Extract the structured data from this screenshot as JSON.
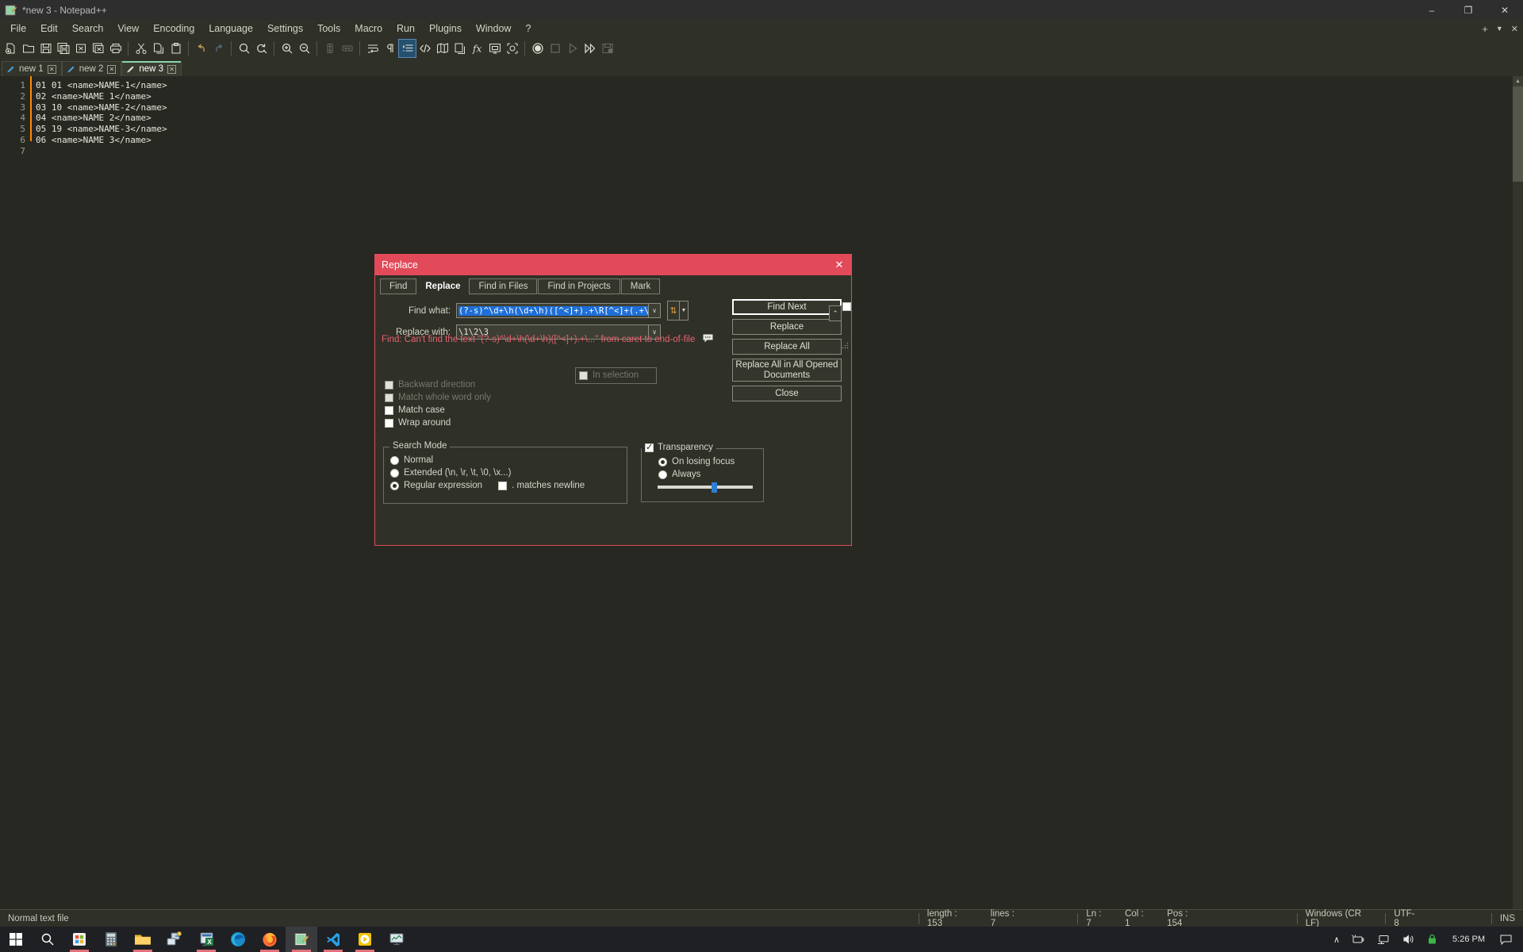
{
  "window": {
    "title": "*new 3 - Notepad++",
    "minimize": "–",
    "maximize": "❐",
    "close": "✕"
  },
  "menubar": {
    "items": [
      {
        "label": "File"
      },
      {
        "label": "Edit"
      },
      {
        "label": "Search"
      },
      {
        "label": "View"
      },
      {
        "label": "Encoding"
      },
      {
        "label": "Language"
      },
      {
        "label": "Settings"
      },
      {
        "label": "Tools"
      },
      {
        "label": "Macro"
      },
      {
        "label": "Run"
      },
      {
        "label": "Plugins"
      },
      {
        "label": "Window"
      },
      {
        "label": "?"
      }
    ],
    "right": {
      "plus": "+",
      "chevron": "▼",
      "close": "✕"
    }
  },
  "toolbar": {
    "icons": [
      "new-file-icon",
      "open-file-icon",
      "save-icon",
      "save-all-icon",
      "close-file-icon",
      "close-all-icon",
      "print-icon",
      "cut-icon",
      "copy-icon",
      "paste-icon",
      "undo-icon",
      "redo-icon",
      "find-icon",
      "replace-icon",
      "zoom-in-icon",
      "zoom-out-icon",
      "sync-vertical-icon",
      "sync-horizontal-icon",
      "word-wrap-icon",
      "show-all-chars-icon",
      "indent-guide-icon",
      "tag-match-icon",
      "document-map-icon",
      "function-list-icon",
      "folder-workspace-icon",
      "monitor-icon",
      "macro-record-icon",
      "macro-stop-icon",
      "macro-play-icon",
      "macro-playmulti-icon",
      "macro-save-icon"
    ]
  },
  "tabs": [
    {
      "label": "new 1",
      "active": false
    },
    {
      "label": "new 2",
      "active": false
    },
    {
      "label": "new 3",
      "active": true
    }
  ],
  "editor": {
    "line_numbers": [
      "1",
      "2",
      "3",
      "4",
      "5",
      "6",
      "7"
    ],
    "lines": [
      "01 01 <name>NAME-1</name>",
      "02 <name>NAME 1</name>",
      "03 10 <name>NAME-2</name>",
      "04 <name>NAME 2</name>",
      "05 19 <name>NAME-3</name>",
      "06 <name>NAME 3</name>",
      ""
    ],
    "current_line_index": 6,
    "scroll_up": "▲",
    "scroll_down": "▼"
  },
  "statusbar": {
    "file_type": "Normal text file",
    "length": "length : 153",
    "lines": "lines : 7",
    "ln": "Ln : 7",
    "col": "Col : 1",
    "pos": "Pos : 154",
    "eol": "Windows (CR LF)",
    "encoding": "UTF-8",
    "insert_mode": "INS"
  },
  "dialog": {
    "title": "Replace",
    "close_label": "✕",
    "tabs": [
      {
        "label": "Find",
        "active": false
      },
      {
        "label": "Replace",
        "active": true
      },
      {
        "label": "Find in Files",
        "active": false
      },
      {
        "label": "Find in Projects",
        "active": false
      },
      {
        "label": "Mark",
        "active": false
      }
    ],
    "find_what_label": "Find what:",
    "find_what_value": "(?-s)^\\d+\\h(\\d+\\h)([^<]+).+\\R[^<]+(.+\\R)",
    "replace_with_label": "Replace with:",
    "replace_with_value": "\\1\\2\\3",
    "combo_arrow": "∨",
    "swap_icon": "⇅",
    "swap_arrow": "▼",
    "buttons": {
      "find_next": "Find Next",
      "replace": "Replace",
      "replace_all": "Replace All",
      "replace_all_opened": "Replace All in All Opened Documents",
      "close": "Close"
    },
    "in_selection_label": "In selection",
    "in_selection_checked": false,
    "in_selection_disabled": true,
    "right_checkbox_checked": false,
    "options": [
      {
        "label": "Backward direction",
        "checked": false,
        "disabled": true
      },
      {
        "label": "Match whole word only",
        "checked": false,
        "disabled": true
      },
      {
        "label": "Match case",
        "checked": false,
        "disabled": false
      },
      {
        "label": "Wrap around",
        "checked": false,
        "disabled": false
      }
    ],
    "search_mode": {
      "title": "Search Mode",
      "options": [
        {
          "label": "Normal",
          "selected": false
        },
        {
          "label": "Extended (\\n, \\r, \\t, \\0, \\x...)",
          "selected": false
        },
        {
          "label": "Regular expression",
          "selected": true
        }
      ],
      "dot_matches_newline_label": ". matches newline",
      "dot_matches_newline_checked": false
    },
    "transparency": {
      "title": "Transparency",
      "checked": true,
      "options": [
        {
          "label": "On losing focus",
          "selected": true
        },
        {
          "label": "Always",
          "selected": false
        }
      ],
      "slider_value": 57
    },
    "collapse_label": "⌃",
    "error_message": "Find: Can't find the text \"(?-s)^\\d+\\h(\\d+\\h)([^<]+).+\\...\" from caret to end-of-file"
  },
  "taskbar": {
    "icons": [
      "windows-start-icon",
      "search-icon",
      "store-icon",
      "calculator-icon",
      "file-explorer-icon",
      "network-tool-icon",
      "excel-icon",
      "edge-icon",
      "firefox-icon",
      "notepadpp-icon",
      "vscode-icon",
      "media-player-icon",
      "chart-app-icon"
    ],
    "tray": {
      "chevron": "∧",
      "battery": "battery-icon",
      "network": "network-icon",
      "volume": "volume-icon",
      "lock": "lock-icon",
      "time": "5:26 PM",
      "notification": "notification-icon"
    }
  },
  "colors": {
    "accent_red": "#e24a5a",
    "editor_bg": "#272822",
    "chrome_bg": "#2f3028",
    "tab_active_underline": "#8fd4a8",
    "selection_blue": "#1e6fd9",
    "caret_orange": "#ff8c00"
  }
}
